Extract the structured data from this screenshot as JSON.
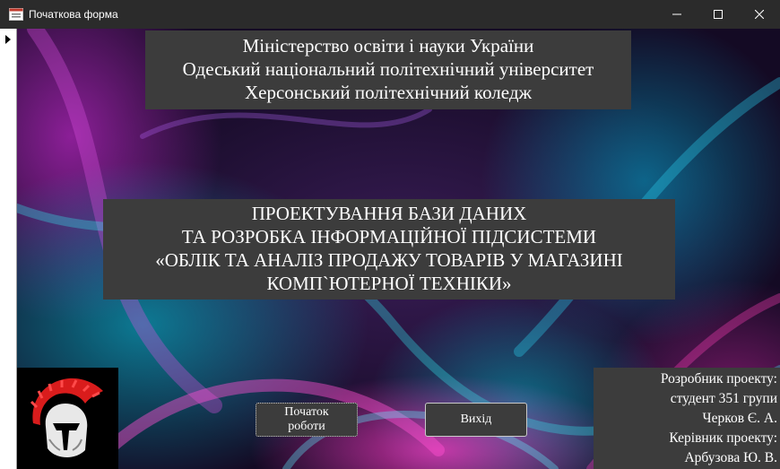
{
  "window": {
    "title": "Початкова форма",
    "icons": {
      "app": "form-icon",
      "minimize": "minimize-icon",
      "maximize": "maximize-icon",
      "close": "close-icon"
    }
  },
  "header": {
    "lines": [
      "Міністерство освіти і науки України",
      "Одеський національний політехнічний університет",
      "Херсонський політехнічний коледж"
    ]
  },
  "project": {
    "lines": [
      "ПРОЕКТУВАННЯ БАЗИ ДАНИХ",
      "ТА РОЗРОБКА ІНФОРМАЦІЙНОЇ ПІДСИСТЕМИ",
      "«ОБЛІК ТА АНАЛІЗ ПРОДАЖУ ТОВАРІВ У МАГАЗИНІ",
      "КОМП`ЮТЕРНОЇ ТЕХНІКИ»"
    ]
  },
  "credits": {
    "lines": [
      "Розробник проекту:",
      "студент 351 групи",
      "Черков Є. А.",
      "Керівник проекту:",
      "Арбузова Ю. В."
    ]
  },
  "buttons": {
    "start": [
      "Початок",
      "роботи"
    ],
    "exit": "Вихід"
  },
  "logo": {
    "icon": "spartan-helmet-icon"
  },
  "colors": {
    "titlebar": "#2b2b2b",
    "panel": "#3c3c3c",
    "text": "#ffffff",
    "plume": "#d91c1c"
  }
}
